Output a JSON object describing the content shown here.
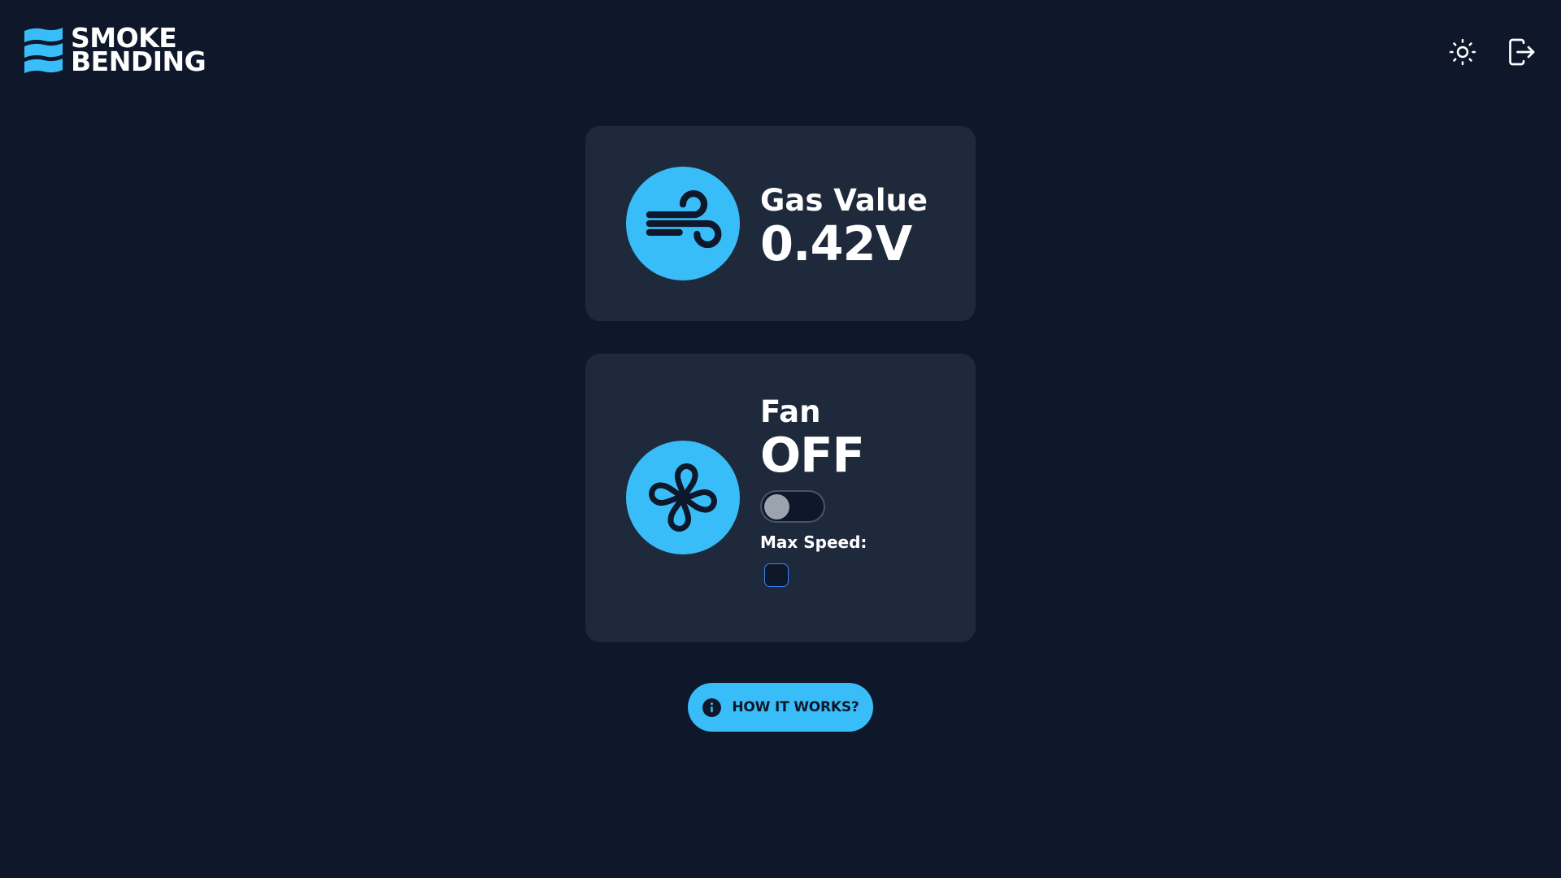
{
  "brand": {
    "line1": "SMOKE",
    "line2": "BENDING",
    "accent_color": "#38bdf8"
  },
  "header": {
    "icons": [
      "sun-icon",
      "logout-icon"
    ]
  },
  "gas": {
    "label": "Gas Value",
    "value": "0.42V",
    "icon": "wind-icon"
  },
  "fan": {
    "label": "Fan",
    "status": "OFF",
    "toggle_on": false,
    "max_speed_label": "Max Speed:",
    "icon": "fan-icon"
  },
  "help_button": {
    "label": "HOW IT WORKS?",
    "icon": "info-icon"
  },
  "colors": {
    "background": "#0f172a",
    "card": "#1e293b",
    "accent": "#38bdf8"
  }
}
